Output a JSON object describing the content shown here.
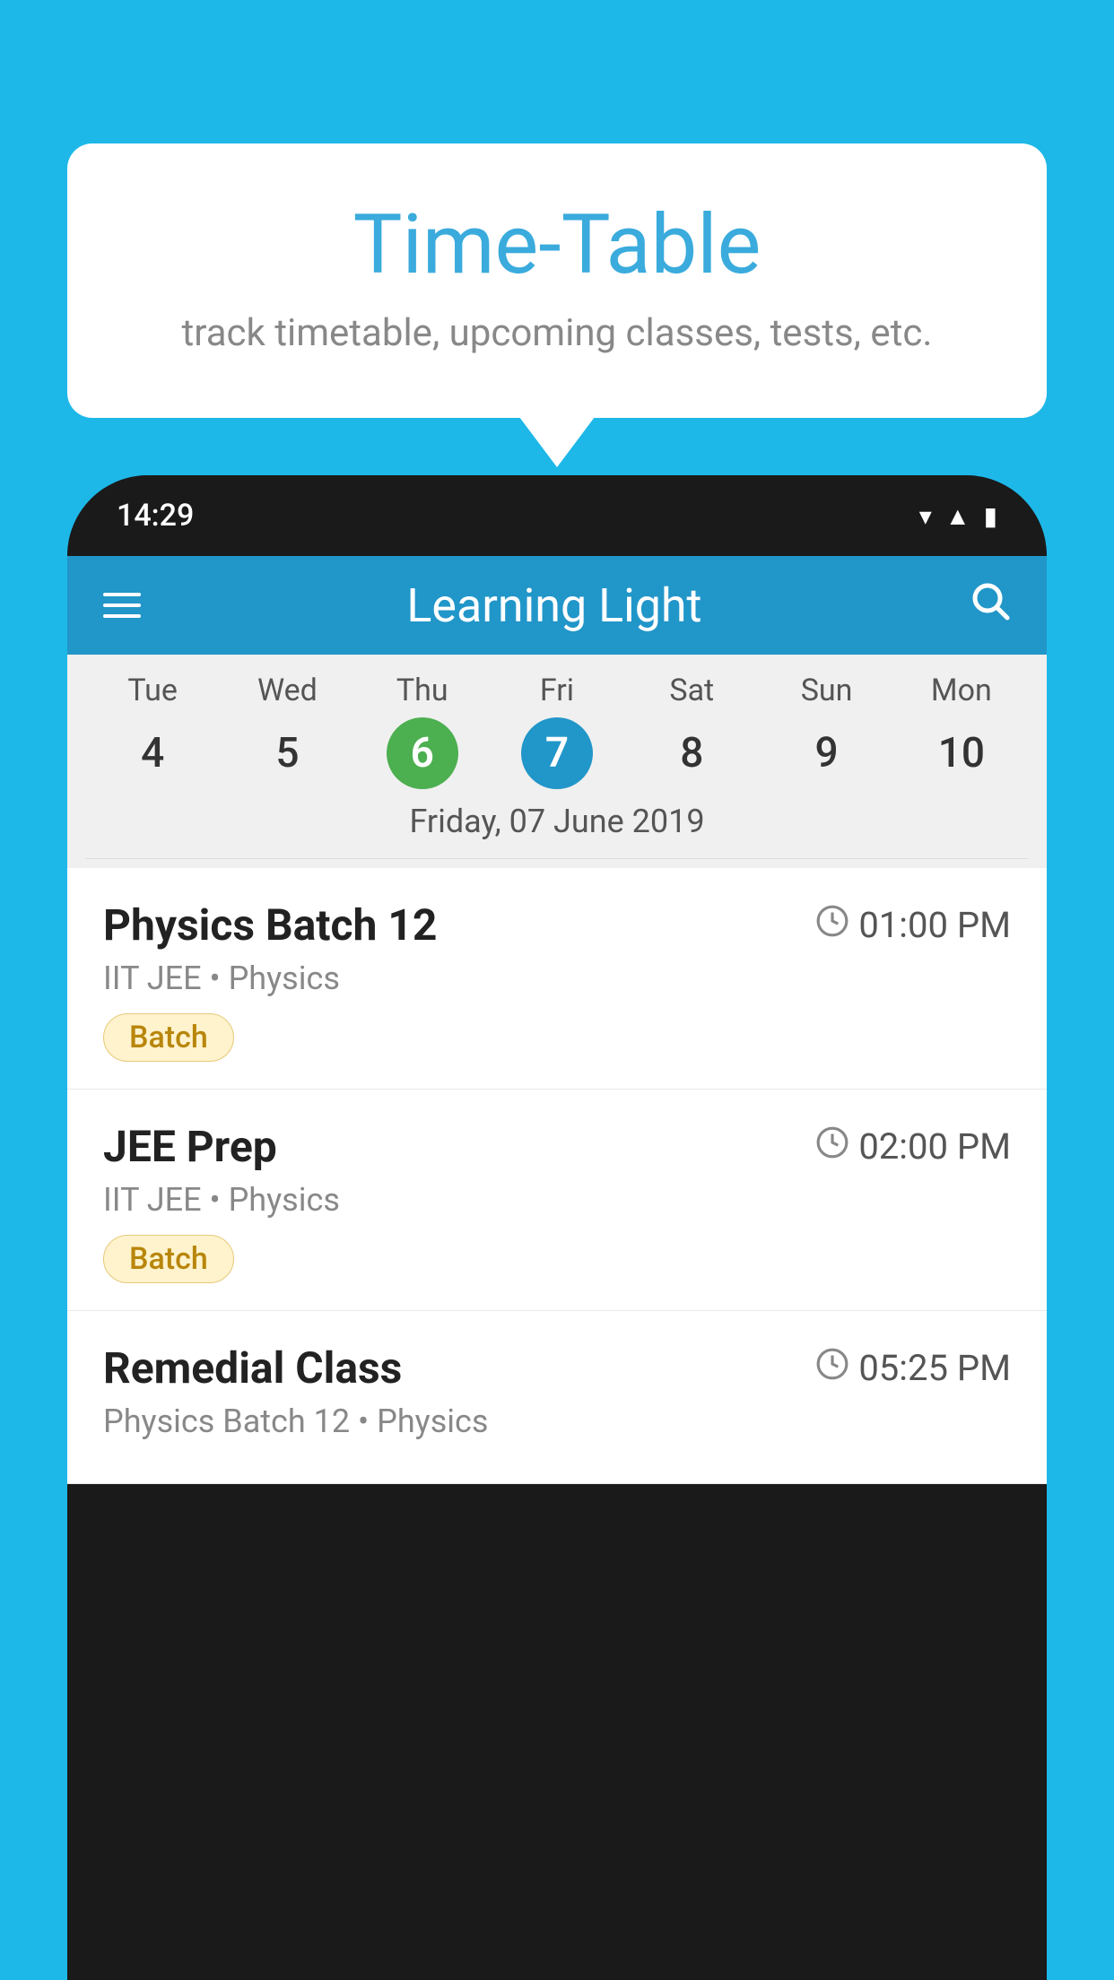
{
  "background_color": "#1eb8e8",
  "speech_bubble": {
    "title": "Time-Table",
    "subtitle": "track timetable, upcoming classes, tests, etc."
  },
  "status_bar": {
    "time": "14:29",
    "icons": [
      "wifi",
      "signal",
      "battery"
    ]
  },
  "app_bar": {
    "title": "Learning Light",
    "menu_icon": "hamburger",
    "search_icon": "search"
  },
  "calendar": {
    "days": [
      {
        "label": "Tue",
        "number": "4"
      },
      {
        "label": "Wed",
        "number": "5"
      },
      {
        "label": "Thu",
        "number": "6",
        "state": "today"
      },
      {
        "label": "Fri",
        "number": "7",
        "state": "selected"
      },
      {
        "label": "Sat",
        "number": "8"
      },
      {
        "label": "Sun",
        "number": "9"
      },
      {
        "label": "Mon",
        "number": "10"
      }
    ],
    "selected_date_label": "Friday, 07 June 2019"
  },
  "classes": [
    {
      "title": "Physics Batch 12",
      "time": "01:00 PM",
      "subtitle": "IIT JEE • Physics",
      "badge": "Batch"
    },
    {
      "title": "JEE Prep",
      "time": "02:00 PM",
      "subtitle": "IIT JEE • Physics",
      "badge": "Batch"
    },
    {
      "title": "Remedial Class",
      "time": "05:25 PM",
      "subtitle": "Physics Batch 12 • Physics",
      "badge": null
    }
  ]
}
